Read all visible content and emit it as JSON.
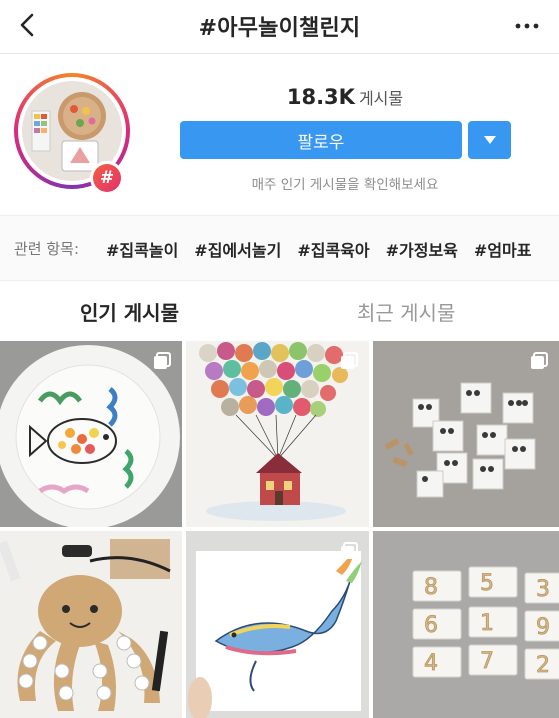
{
  "header": {
    "title": "#아무놀이챌린지"
  },
  "profile": {
    "post_count": "18.3K",
    "post_label": "게시물",
    "follow_label": "팔로우",
    "subtext": "매주 인기 게시물을 확인해보세요",
    "badge": "#"
  },
  "related": {
    "label": "관련 항목:",
    "tags": [
      "#집콕놀이",
      "#집에서놀기",
      "#집콕육아",
      "#가정보육",
      "#엄마표"
    ]
  },
  "tabs": {
    "top": "인기 게시물",
    "recent": "최근 게시물"
  },
  "grid": {
    "posts": [
      {
        "subject": "fish-plate-craft",
        "multiple": true
      },
      {
        "subject": "balloon-house-painting",
        "multiple": true
      },
      {
        "subject": "number-cards-craft",
        "multiple": true
      },
      {
        "subject": "octopus-cardboard-craft",
        "multiple": false
      },
      {
        "subject": "whale-painting",
        "multiple": true
      },
      {
        "subject": "wooden-number-cards",
        "multiple": false
      }
    ],
    "number_cards": [
      "8",
      "5",
      "3",
      "6",
      "1",
      "9",
      "4",
      "7",
      "2"
    ]
  },
  "colors": {
    "accent": "#3897f0",
    "badge": "#e1306c"
  }
}
